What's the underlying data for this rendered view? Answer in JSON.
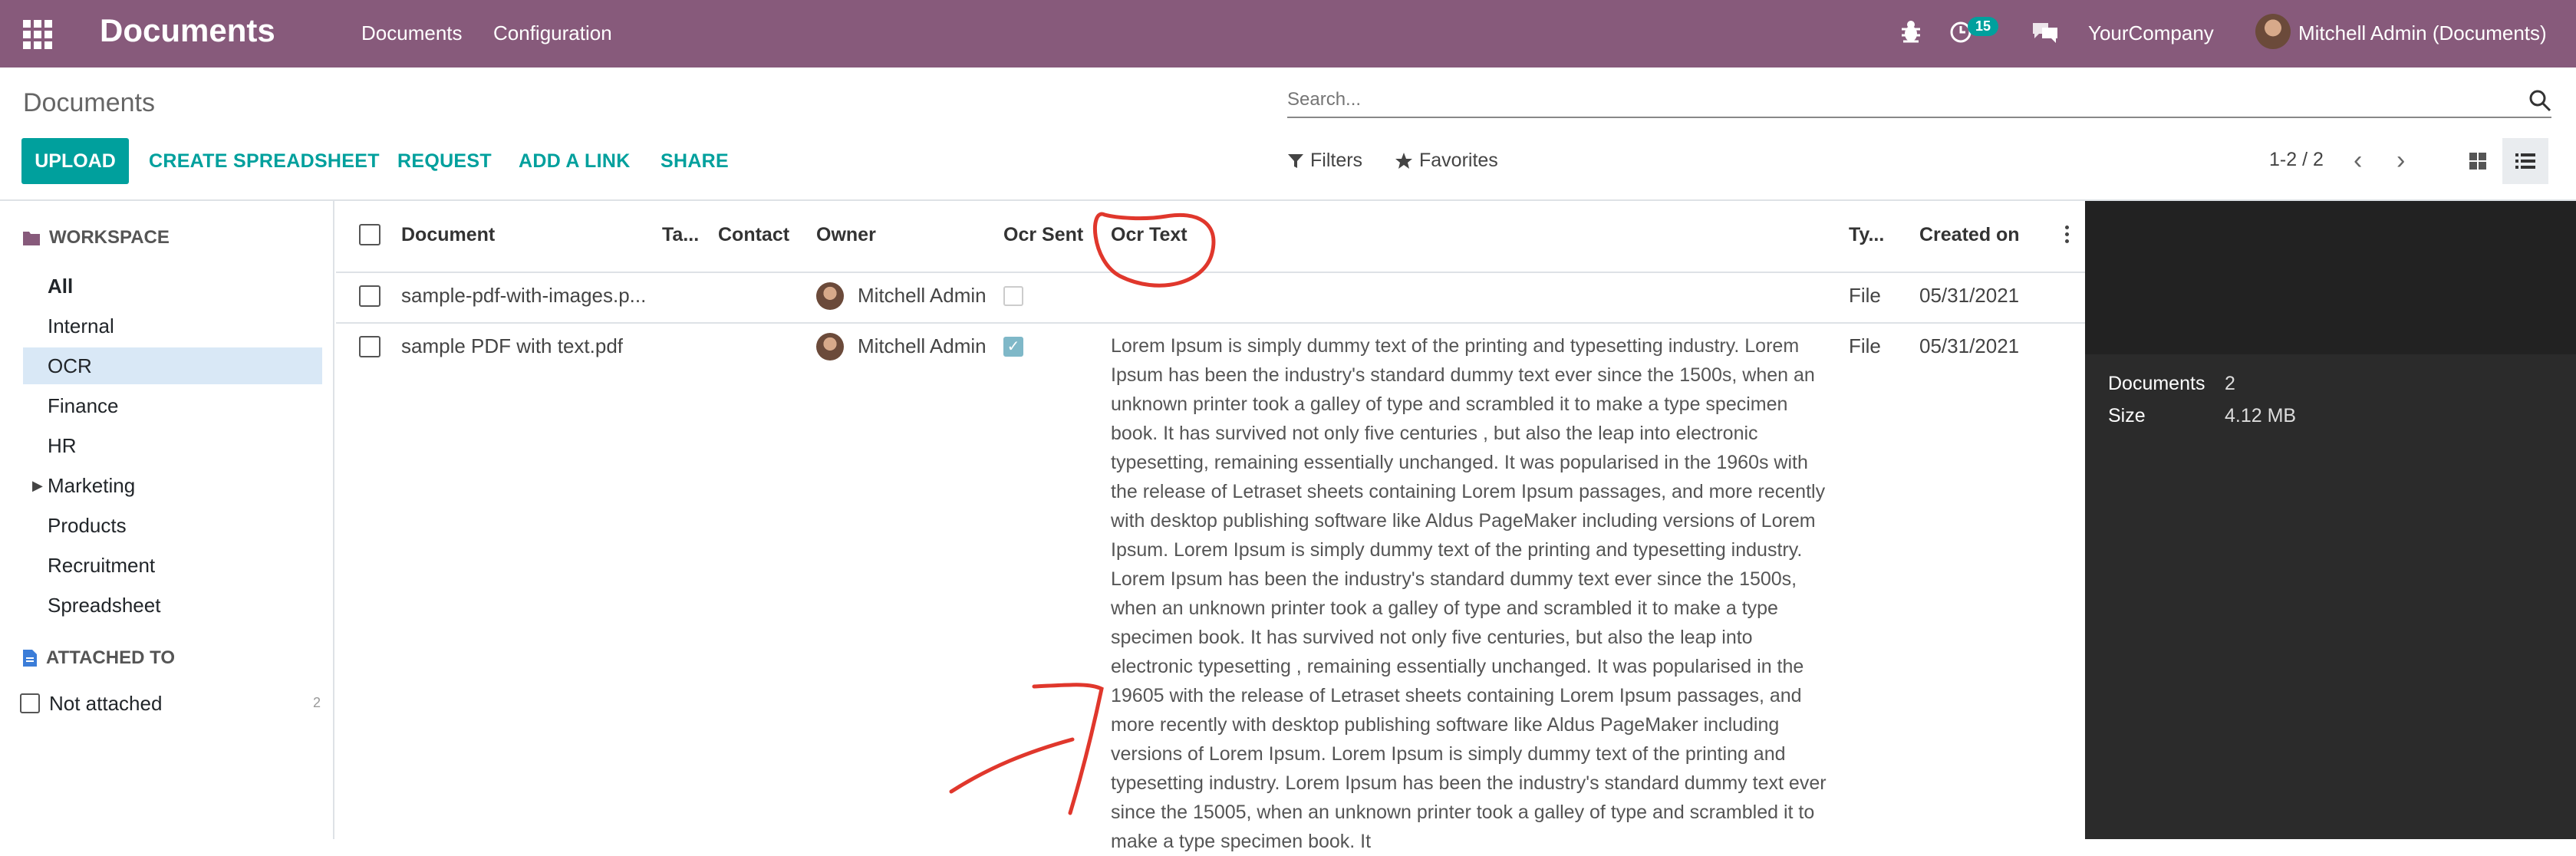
{
  "topbar": {
    "app_title": "Documents",
    "menu": [
      "Documents",
      "Configuration"
    ],
    "activity_count": "15",
    "company": "YourCompany",
    "user": "Mitchell Admin (Documents)",
    "bg_color": "#875a7b"
  },
  "control_panel": {
    "title": "Documents",
    "search_placeholder": "Search...",
    "buttons": {
      "upload": "UPLOAD",
      "create_spreadsheet": "CREATE SPREADSHEET",
      "request": "REQUEST",
      "add_link": "ADD A LINK",
      "share": "SHARE"
    },
    "filters": "Filters",
    "favorites": "Favorites",
    "pager": "1-2 / 2",
    "accent_color": "#00a09d"
  },
  "sidebar": {
    "workspace_title": "WORKSPACE",
    "items": [
      "All",
      "Internal",
      "OCR",
      "Finance",
      "HR",
      "Marketing",
      "Products",
      "Recruitment",
      "Spreadsheet"
    ],
    "active_item": "OCR",
    "attached_title": "ATTACHED TO",
    "not_attached": "Not attached",
    "not_attached_count": "2"
  },
  "table": {
    "headers": [
      "Document",
      "Ta...",
      "Contact",
      "Owner",
      "Ocr Sent",
      "Ocr Text",
      "Ty...",
      "Created on"
    ],
    "rows": [
      {
        "document": "sample-pdf-with-images.p...",
        "owner": "Mitchell Admin",
        "ocr_sent": false,
        "type": "File",
        "created_on": "05/31/2021",
        "ocr_text": ""
      },
      {
        "document": "sample PDF with text.pdf",
        "owner": "Mitchell Admin",
        "ocr_sent": true,
        "type": "File",
        "created_on": "05/31/2021",
        "ocr_text": "Lorem Ipsum is simply dummy text of the printing and typesetting industry. Lorem Ipsum has been the industry's standard dummy text ever since the 1500s, when an unknown printer took a galley of type and scrambled it to make a type specimen book. It has survived not only five centuries , but also the leap into electronic typesetting, remaining  essentially unchanged. It was popularised in the 1960s with the release of Letraset sheets containing Lorem Ipsum passages, and more recently with desktop publishing software like Aldus PageMaker including versions of Lorem Ipsum. Lorem Ipsum is simply dummy text of the printing and typesetting industry. Lorem Ipsum has been the industry's standard dummy text ever since the 1500s, when an unknown printer took a galley of type and scrambled it to make a type specimen book. It has survived not only five centuries, but also the leap into electronic typesetting ,  remaining   essentially unchanged. It was popularised in the 19605 with the release of Letraset sheets containing Lorem Ipsum passages, and more recently with desktop publishing software like Aldus PageMaker including versions of Lorem Ipsum. Lorem Ipsum is simply dummy text of the printing and typesetting industry. Lorem Ipsum has been the industry's standard dummy text ever since the 15005, when an unknown printer took a galley of type and scrambled it to make a type specimen book. It"
      }
    ]
  },
  "preview": {
    "documents_label": "Documents",
    "documents_value": "2",
    "size_label": "Size",
    "size_value": "4.12 MB"
  }
}
